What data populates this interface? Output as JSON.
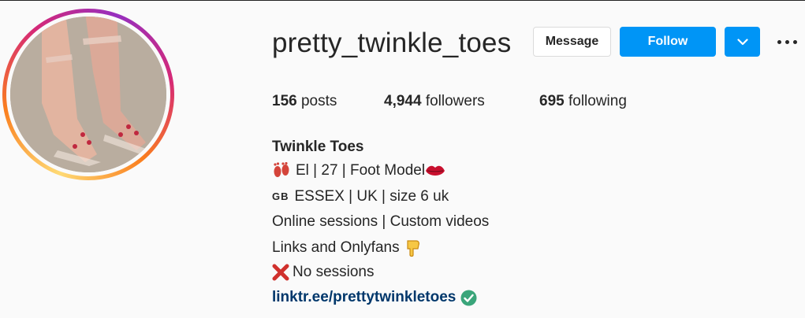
{
  "profile": {
    "username": "pretty_twinkle_toes",
    "full_name": "Twinkle Toes",
    "posts_count": "156",
    "posts_label": "posts",
    "followers_count": "4,944",
    "followers_label": "followers",
    "following_count": "695",
    "following_label": "following"
  },
  "actions": {
    "message_label": "Message",
    "follow_label": "Follow"
  },
  "bio": {
    "line1": "El | 27 | Foot Model",
    "line2_flag": "GB",
    "line2": "ESSEX | UK | size 6 uk",
    "line3": "Online sessions | Custom videos",
    "line4": "Links and Onlyfans",
    "line5": "No sessions",
    "link": "linktr.ee/prettytwinkletoes"
  },
  "colors": {
    "follow_button": "#0095f6",
    "link": "#00376b",
    "verified_check": "#3aa57a"
  },
  "icons": [
    "footprints-icon",
    "lips-icon",
    "pointing-down-icon",
    "red-x-icon",
    "verified-check-icon",
    "chevron-down-icon",
    "more-options-icon"
  ]
}
